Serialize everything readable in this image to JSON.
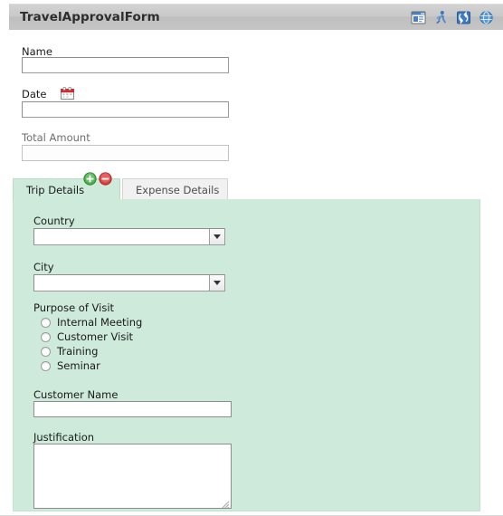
{
  "window": {
    "title": "TravelApprovalForm",
    "icons": [
      {
        "name": "form-preview-icon",
        "title": "Preview Form"
      },
      {
        "name": "run-icon",
        "title": "Run"
      },
      {
        "name": "refresh-icon",
        "title": "Refresh"
      },
      {
        "name": "globe-icon",
        "title": "Open in Browser"
      }
    ]
  },
  "form": {
    "fields": [
      {
        "key": "name",
        "label": "Name",
        "value": "",
        "placeholder": "",
        "muted": false,
        "has_calendar": false
      },
      {
        "key": "date",
        "label": "Date",
        "value": "",
        "placeholder": "",
        "muted": false,
        "has_calendar": true
      },
      {
        "key": "total",
        "label": "Total Amount",
        "value": "",
        "placeholder": "",
        "muted": true,
        "has_calendar": false
      }
    ]
  },
  "tabs": {
    "items": [
      {
        "key": "trip",
        "label": "Trip Details",
        "active": true
      },
      {
        "key": "expense",
        "label": "Expense Details",
        "active": false
      }
    ],
    "tools": [
      {
        "name": "add-tab-button",
        "label": "+",
        "color": "#3faa3f"
      },
      {
        "name": "remove-tab-button",
        "label": "−",
        "color": "#d83b3b"
      }
    ]
  },
  "panel": {
    "background": "#cdeada",
    "country": {
      "label": "Country",
      "value": "",
      "options": []
    },
    "city": {
      "label": "City",
      "value": "",
      "options": []
    },
    "purpose": {
      "label": "Purpose of Visit",
      "options": [
        {
          "key": "internal-meeting",
          "label": "Internal Meeting",
          "checked": false
        },
        {
          "key": "customer-visit",
          "label": "Customer Visit",
          "checked": false
        },
        {
          "key": "training",
          "label": "Training",
          "checked": false
        },
        {
          "key": "seminar",
          "label": "Seminar",
          "checked": false
        }
      ]
    },
    "customer_name": {
      "label": "Customer Name",
      "value": "",
      "placeholder": ""
    },
    "justification": {
      "label": "Justification",
      "value": "",
      "placeholder": ""
    }
  }
}
